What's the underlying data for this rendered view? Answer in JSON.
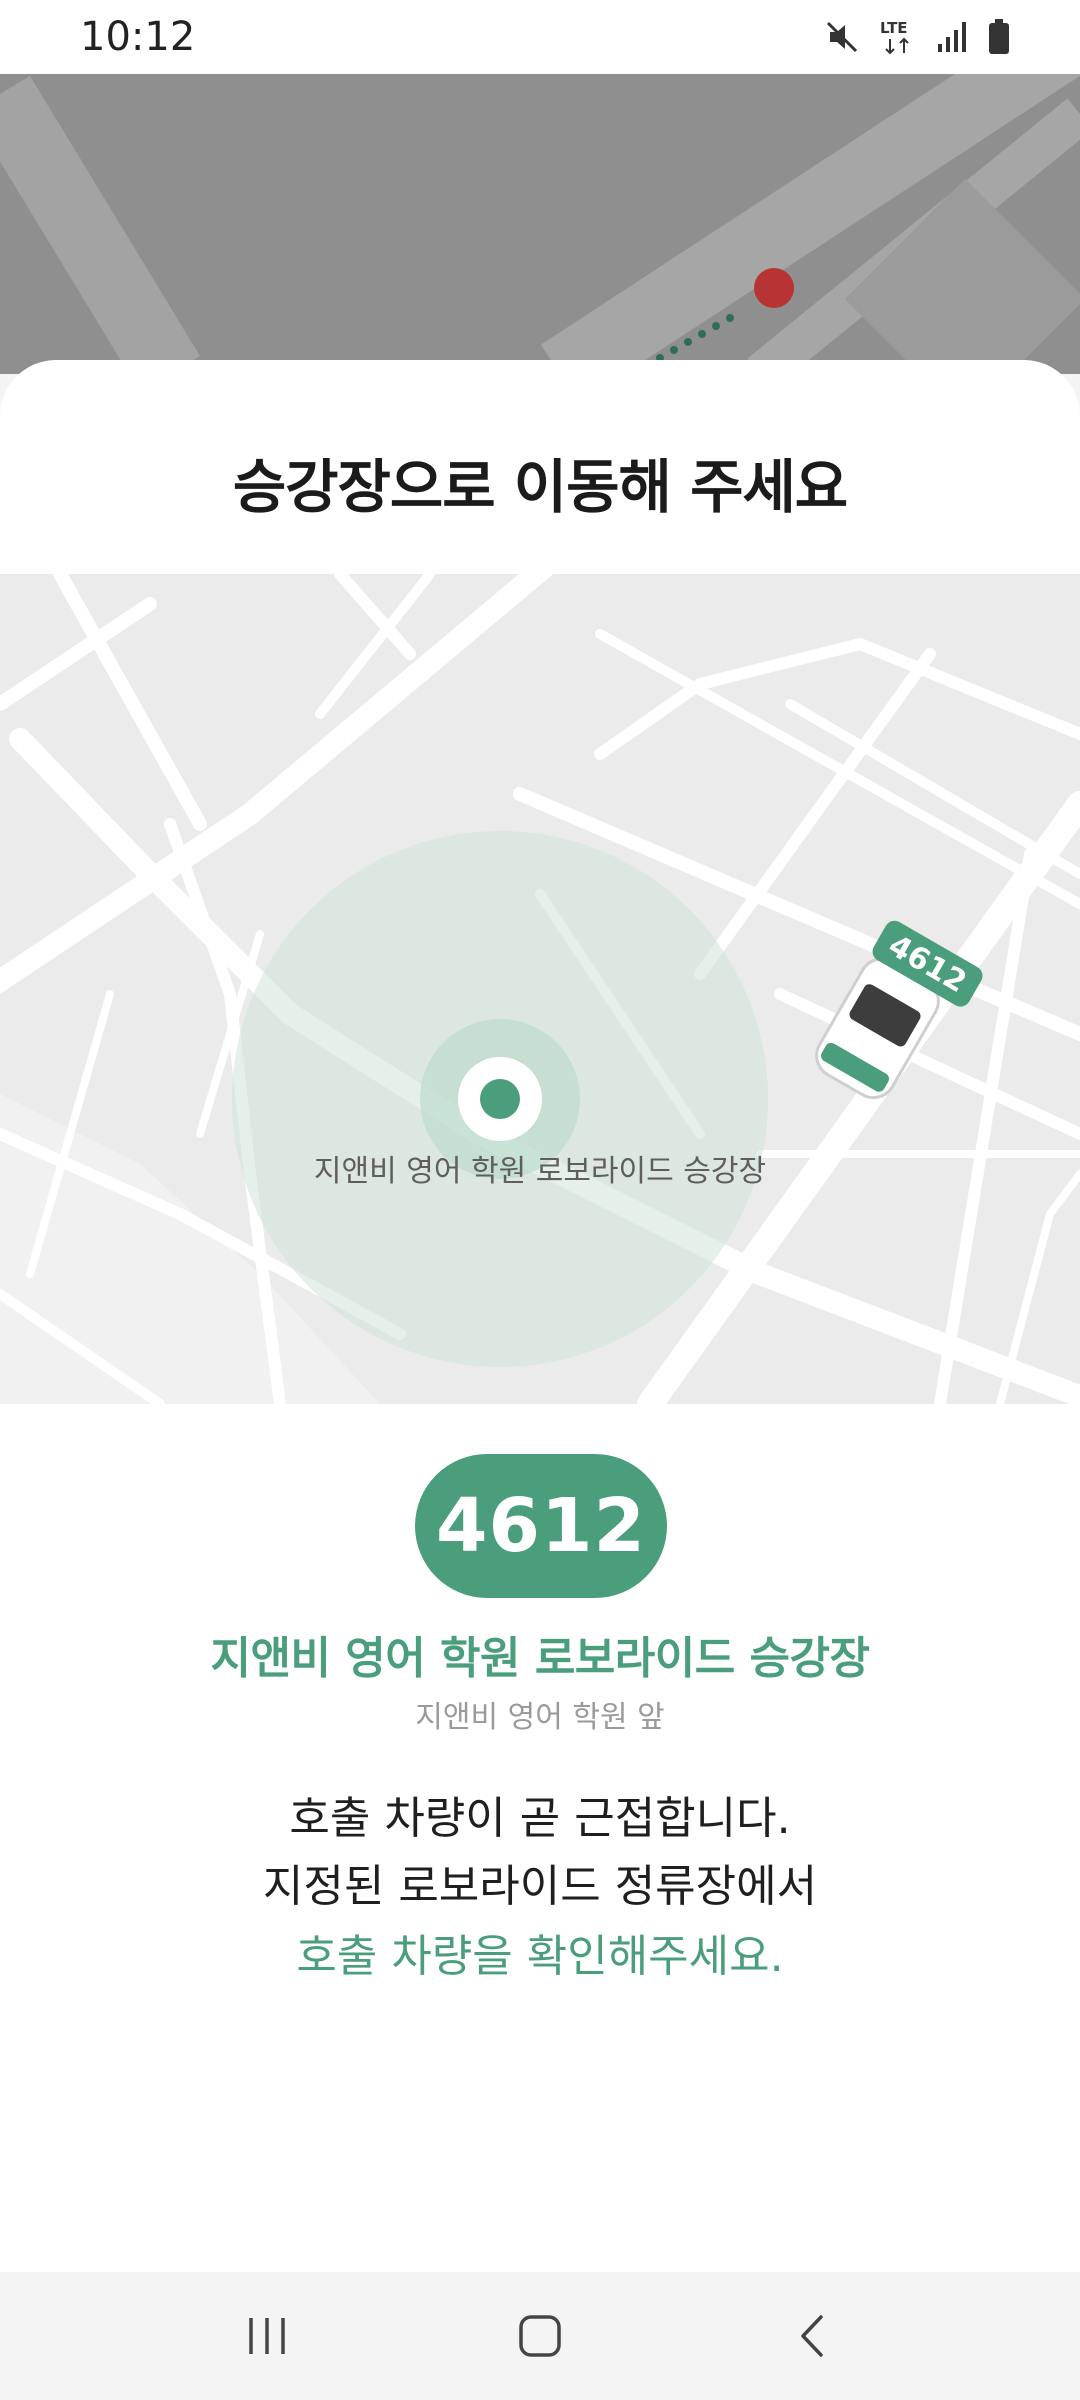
{
  "status_bar": {
    "time": "10:12",
    "network": "LTE",
    "icons": [
      "mute-icon",
      "lte-icon",
      "signal-icon",
      "battery-icon"
    ]
  },
  "sheet": {
    "title": "승강장으로 이동해 주세요"
  },
  "map": {
    "stop_label": "지앤비 영어 학원 로보라이드 승강장",
    "vehicle_tag": "4612",
    "colors": {
      "accent": "#4a9e7c",
      "road": "#ffffff",
      "land": "#ebebeb",
      "radius": "#cfe3d8"
    }
  },
  "vehicle": {
    "number": "4612"
  },
  "stop": {
    "name": "지앤비 영어 학원 로보라이드 승강장",
    "sub": "지앤비 영어 학원 앞"
  },
  "message": {
    "line1": "호출 차량이 곧 근접합니다.",
    "line2": "지정된 로보라이드 정류장에서",
    "line3": "호출 차량을 확인해주세요."
  },
  "nav_bar": {
    "items": [
      "recent-apps-icon",
      "home-icon",
      "back-icon"
    ]
  }
}
